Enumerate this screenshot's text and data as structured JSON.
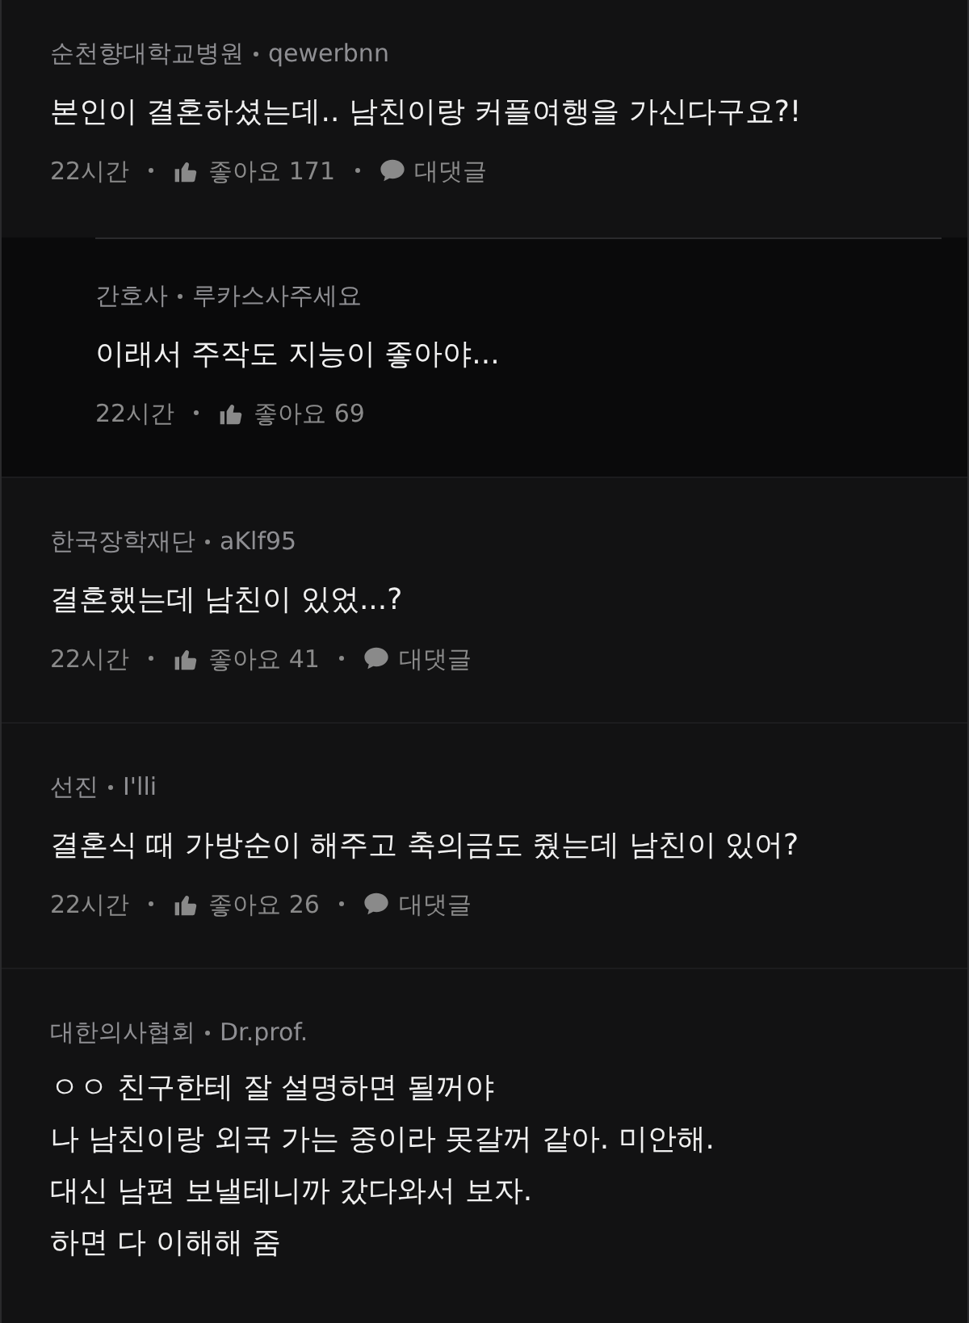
{
  "comments": [
    {
      "kind": "comment",
      "org": "순천향대학교병원",
      "nick": "qewerbnn",
      "lines": [
        "본인이 결혼하셨는데.. 남친이랑 커플여행을 가신다구요?!"
      ],
      "time": "22시간",
      "likes": "좋아요 171",
      "reply": "대댓글"
    },
    {
      "kind": "reply",
      "org": "간호사",
      "nick": "루카스사주세요",
      "lines": [
        "이래서 주작도 지능이 좋아야..."
      ],
      "time": "22시간",
      "likes": "좋아요 69"
    },
    {
      "kind": "comment",
      "org": "한국장학재단",
      "nick": "aKlf95",
      "lines": [
        "결혼했는데 남친이 있었...?"
      ],
      "time": "22시간",
      "likes": "좋아요 41",
      "reply": "대댓글"
    },
    {
      "kind": "comment",
      "org": "선진",
      "nick": "I'lli",
      "lines": [
        "결혼식 때 가방순이 해주고 축의금도 줬는데 남친이 있어?"
      ],
      "time": "22시간",
      "likes": "좋아요 26",
      "reply": "대댓글"
    },
    {
      "kind": "comment",
      "org": "대한의사협회",
      "nick": "Dr.prof.",
      "lines": [
        "ㅇㅇ 친구한테 잘 설명하면 될꺼야",
        "나 남친이랑 외국 가는 중이라 못갈꺼 같아. 미안해.",
        "대신 남편 보낼테니까 갔다와서 보자.",
        "하면 다 이해해 줌"
      ]
    }
  ]
}
